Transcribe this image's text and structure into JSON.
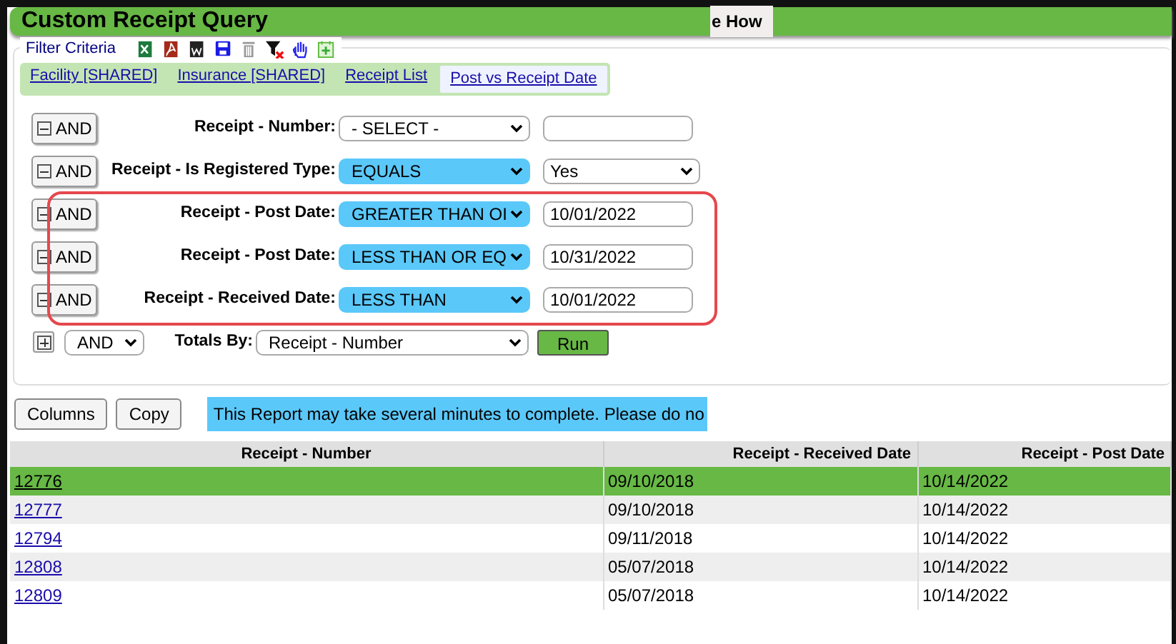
{
  "title": "Custom Receipt Query",
  "title_overlay": "e How",
  "filter": {
    "legend": "Filter Criteria",
    "tools": [
      {
        "kind": "excel"
      },
      {
        "kind": "pdf"
      },
      {
        "kind": "word"
      },
      {
        "kind": "save"
      },
      {
        "kind": "trash"
      },
      {
        "kind": "clear-filter"
      },
      {
        "kind": "hand"
      },
      {
        "kind": "add"
      }
    ],
    "tabs": [
      {
        "label": "Facility [SHARED]",
        "selected": false
      },
      {
        "label": "Insurance [SHARED]",
        "selected": false
      },
      {
        "label": "Receipt List",
        "selected": false
      },
      {
        "label": "Post vs Receipt Date",
        "selected": true
      }
    ],
    "rows": [
      {
        "connector": "AND",
        "field": "Receipt - Number:",
        "operator": "- SELECT -",
        "operator_set": false,
        "kind": "text",
        "highlighted": false
      },
      {
        "connector": "AND",
        "field": "Receipt - Is Registered Type:",
        "operator": "EQUALS",
        "operator_set": true,
        "kind": "select",
        "value": "Yes",
        "highlighted": false
      },
      {
        "connector": "AND",
        "field": "Receipt - Post Date:",
        "operator": "GREATER THAN OI",
        "operator_set": true,
        "kind": "text",
        "value": "10/01/2022",
        "highlighted": true
      },
      {
        "connector": "AND",
        "field": "Receipt - Post Date:",
        "operator": "LESS THAN OR EQ",
        "operator_set": true,
        "kind": "text",
        "value": "10/31/2022",
        "highlighted": true
      },
      {
        "connector": "AND",
        "field": "Receipt - Received Date:",
        "operator": "LESS THAN",
        "operator_set": true,
        "kind": "text",
        "value": "10/01/2022",
        "highlighted": true
      }
    ],
    "add_connector": "AND",
    "totals_label": "Totals By:",
    "totals_value": "Receipt - Number",
    "run_label": "Run"
  },
  "actions": [
    "Columns",
    "Copy"
  ],
  "notice": "This Report may take several minutes to complete. Please do no",
  "table": {
    "columns": [
      "Receipt - Number",
      "Receipt - Received Date",
      "Receipt - Post Date"
    ],
    "rows": [
      {
        "cells": [
          "12776",
          "09/10/2018",
          "10/14/2022"
        ],
        "selected": true
      },
      {
        "cells": [
          "12777",
          "09/10/2018",
          "10/14/2022"
        ],
        "selected": false
      },
      {
        "cells": [
          "12794",
          "09/11/2018",
          "10/14/2022"
        ],
        "selected": false
      },
      {
        "cells": [
          "12808",
          "05/07/2018",
          "10/14/2022"
        ],
        "selected": false
      },
      {
        "cells": [
          "12809",
          "05/07/2018",
          "10/14/2022"
        ],
        "selected": false
      }
    ]
  }
}
